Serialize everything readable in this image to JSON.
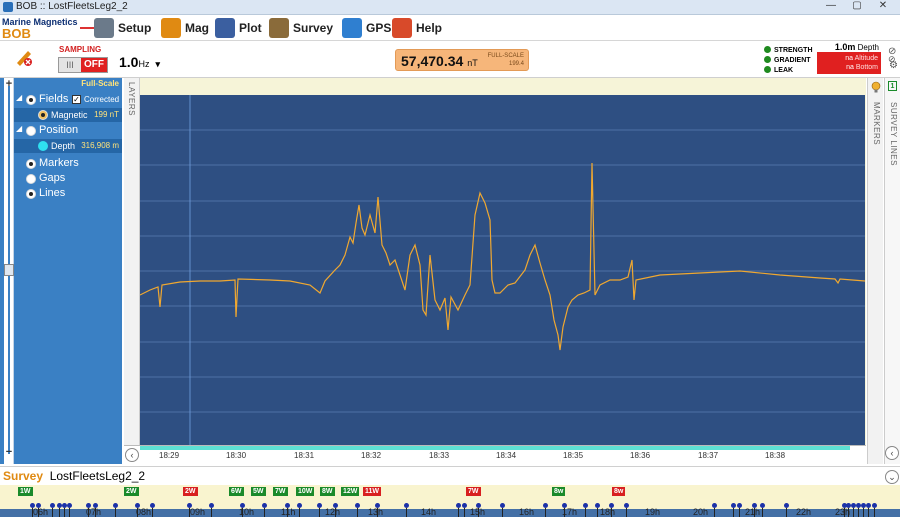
{
  "window": {
    "title": "BOB :: LostFleetsLeg2_2"
  },
  "brand": {
    "line1": "Marine Magnetics",
    "line2": "BOB"
  },
  "menu": [
    {
      "label": "Setup",
      "icon": "wrench-icon",
      "color": "#6b7a8a"
    },
    {
      "label": "Mag",
      "icon": "magnet-icon",
      "color": "#e08a12"
    },
    {
      "label": "Plot",
      "icon": "plot-icon",
      "color": "#3b5fa0"
    },
    {
      "label": "Survey",
      "icon": "survey-icon",
      "color": "#8a6b3a"
    },
    {
      "label": "GPS",
      "icon": "globe-icon",
      "color": "#2f7fd0"
    },
    {
      "label": "Help",
      "icon": "lifebuoy-icon",
      "color": "#d84a2a"
    }
  ],
  "controls": {
    "sampling_label": "SAMPLING",
    "toggle_off": "OFF",
    "toggle_on": "III",
    "rate": "1.0",
    "rate_unit": "Hz",
    "rate_dropdown": "▾",
    "reading": "57,470.34",
    "reading_unit": "nT",
    "fullscale_label": "FULL-SCALE",
    "fullscale_value": "199.4",
    "indicators": [
      "STRENGTH",
      "GRADIENT",
      "LEAK"
    ],
    "depth_value": "1.0",
    "depth_unit": "m",
    "depth_label": "Depth",
    "depth_rows": [
      {
        "value": "na",
        "label": "Altitude"
      },
      {
        "value": "na",
        "label": "Bottom"
      }
    ]
  },
  "left_panel": {
    "fullscale": "Full-Scale",
    "tree": {
      "fields": "Fields",
      "corrected": "Corrected",
      "magnetic": "Magnetic",
      "magnetic_value": "199 nT",
      "position": "Position",
      "depth": "Depth",
      "depth_value": "316,908 m",
      "markers": "Markers",
      "gaps": "Gaps",
      "lines": "Lines"
    }
  },
  "plot": {
    "layers_label": "LAYERS",
    "markers_label": "MARKERS",
    "survey_lines_label": "SURVEY LINES",
    "survey_lines_count": "1",
    "x_ticks": [
      "18:29",
      "18:30",
      "18:31",
      "18:32",
      "18:33",
      "18:34",
      "18:35",
      "18:36",
      "18:37",
      "18:38"
    ],
    "trace_color": "#f0a830",
    "background": "#2e4f82"
  },
  "survey": {
    "label": "Survey",
    "name": "LostFleetsLeg2_2",
    "lines": [
      {
        "label": "1W",
        "status": "green"
      },
      {
        "label": "2W",
        "status": "green"
      },
      {
        "label": "2W",
        "status": "red"
      },
      {
        "label": "6W",
        "status": "green"
      },
      {
        "label": "5W",
        "status": "green"
      },
      {
        "label": "7W",
        "status": "green"
      },
      {
        "label": "10W",
        "status": "green"
      },
      {
        "label": "8W",
        "status": "green"
      },
      {
        "label": "12W",
        "status": "green"
      },
      {
        "label": "11W",
        "status": "red"
      },
      {
        "label": "7W",
        "status": "red"
      },
      {
        "label": "8w",
        "status": "green"
      },
      {
        "label": "8w",
        "status": "red"
      }
    ],
    "hours": [
      "06h",
      "07h",
      "08h",
      "09h",
      "10h",
      "11h",
      "12h",
      "13h",
      "14h",
      "15h",
      "16h",
      "17h",
      "18h",
      "19h",
      "20h",
      "21h",
      "22h",
      "23h"
    ]
  }
}
